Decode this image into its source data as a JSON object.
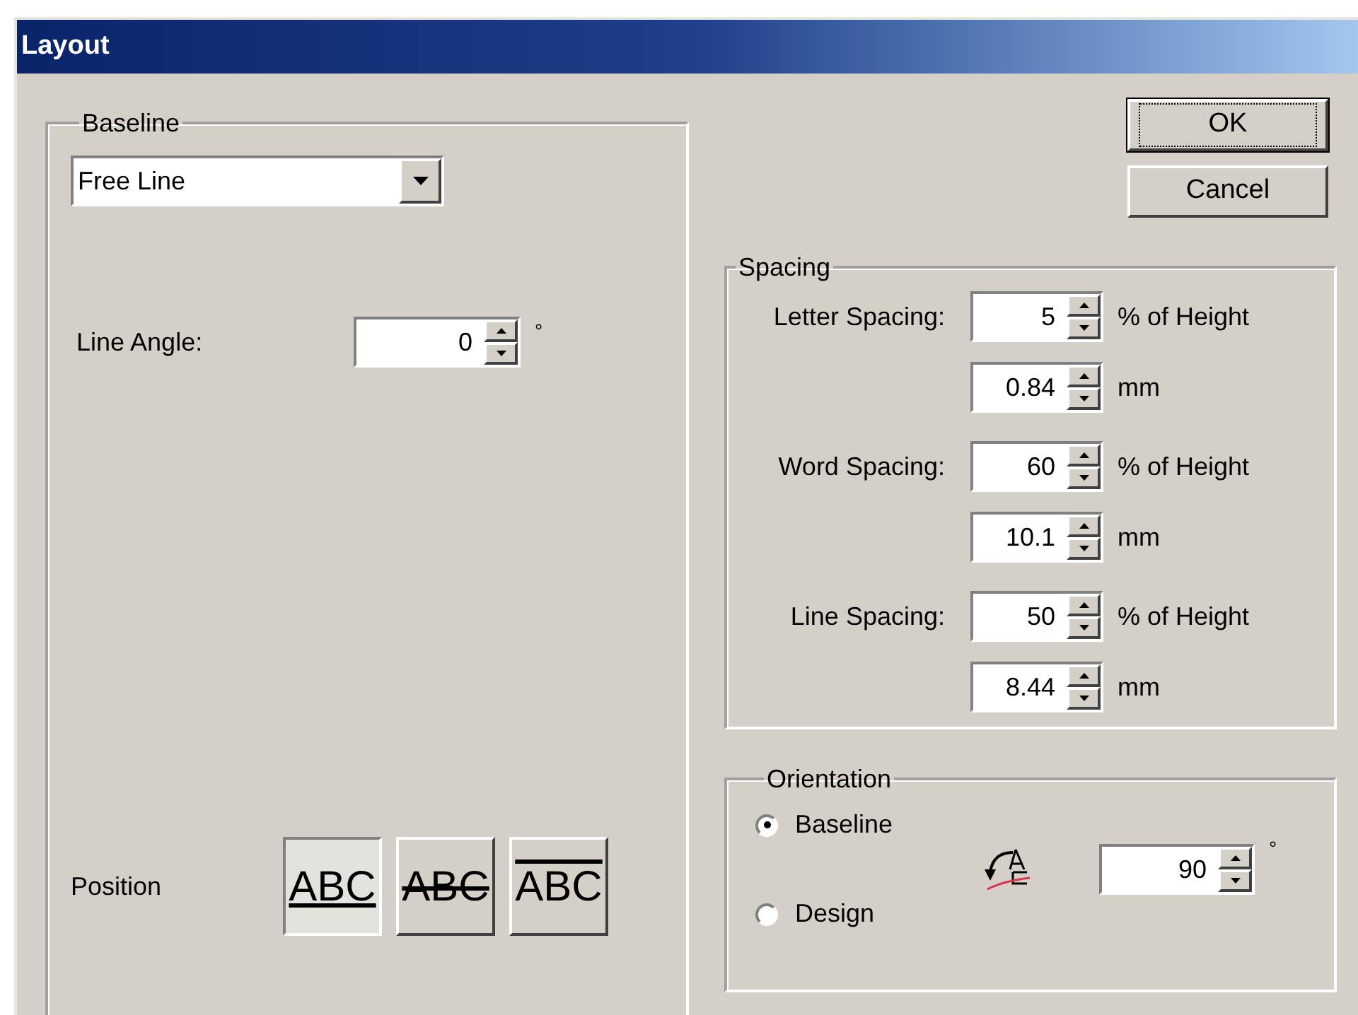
{
  "window": {
    "title": "Layout"
  },
  "baseline_group": {
    "title": "Baseline",
    "dropdown": {
      "value": "Free Line"
    },
    "line_angle": {
      "label": "Line Angle:",
      "value": "0",
      "unit": "°"
    },
    "position": {
      "label": "Position",
      "options": [
        {
          "text": "ABC",
          "kind": "underline",
          "selected": true
        },
        {
          "text": "ABC",
          "kind": "strike",
          "selected": false
        },
        {
          "text": "ABC",
          "kind": "overline",
          "selected": false
        }
      ]
    }
  },
  "buttons": [
    {
      "label": "OK",
      "default": true
    },
    {
      "label": "Cancel",
      "default": false
    }
  ],
  "spacing": {
    "title": "Spacing",
    "rows": [
      {
        "label": "Letter Spacing:",
        "fields": [
          {
            "value": "5",
            "unit": "% of Height"
          },
          {
            "value": "0.84",
            "unit": "mm"
          }
        ]
      },
      {
        "label": "Word Spacing:",
        "fields": [
          {
            "value": "60",
            "unit": "% of Height"
          },
          {
            "value": "10.1",
            "unit": "mm"
          }
        ]
      },
      {
        "label": "Line Spacing:",
        "fields": [
          {
            "value": "50",
            "unit": "% of Height"
          },
          {
            "value": "8.44",
            "unit": "mm"
          }
        ]
      }
    ]
  },
  "orientation": {
    "title": "Orientation",
    "options": [
      {
        "label": "Baseline",
        "selected": true
      },
      {
        "label": "Design",
        "selected": false
      }
    ],
    "angle": {
      "value": "90",
      "unit": "°"
    }
  }
}
